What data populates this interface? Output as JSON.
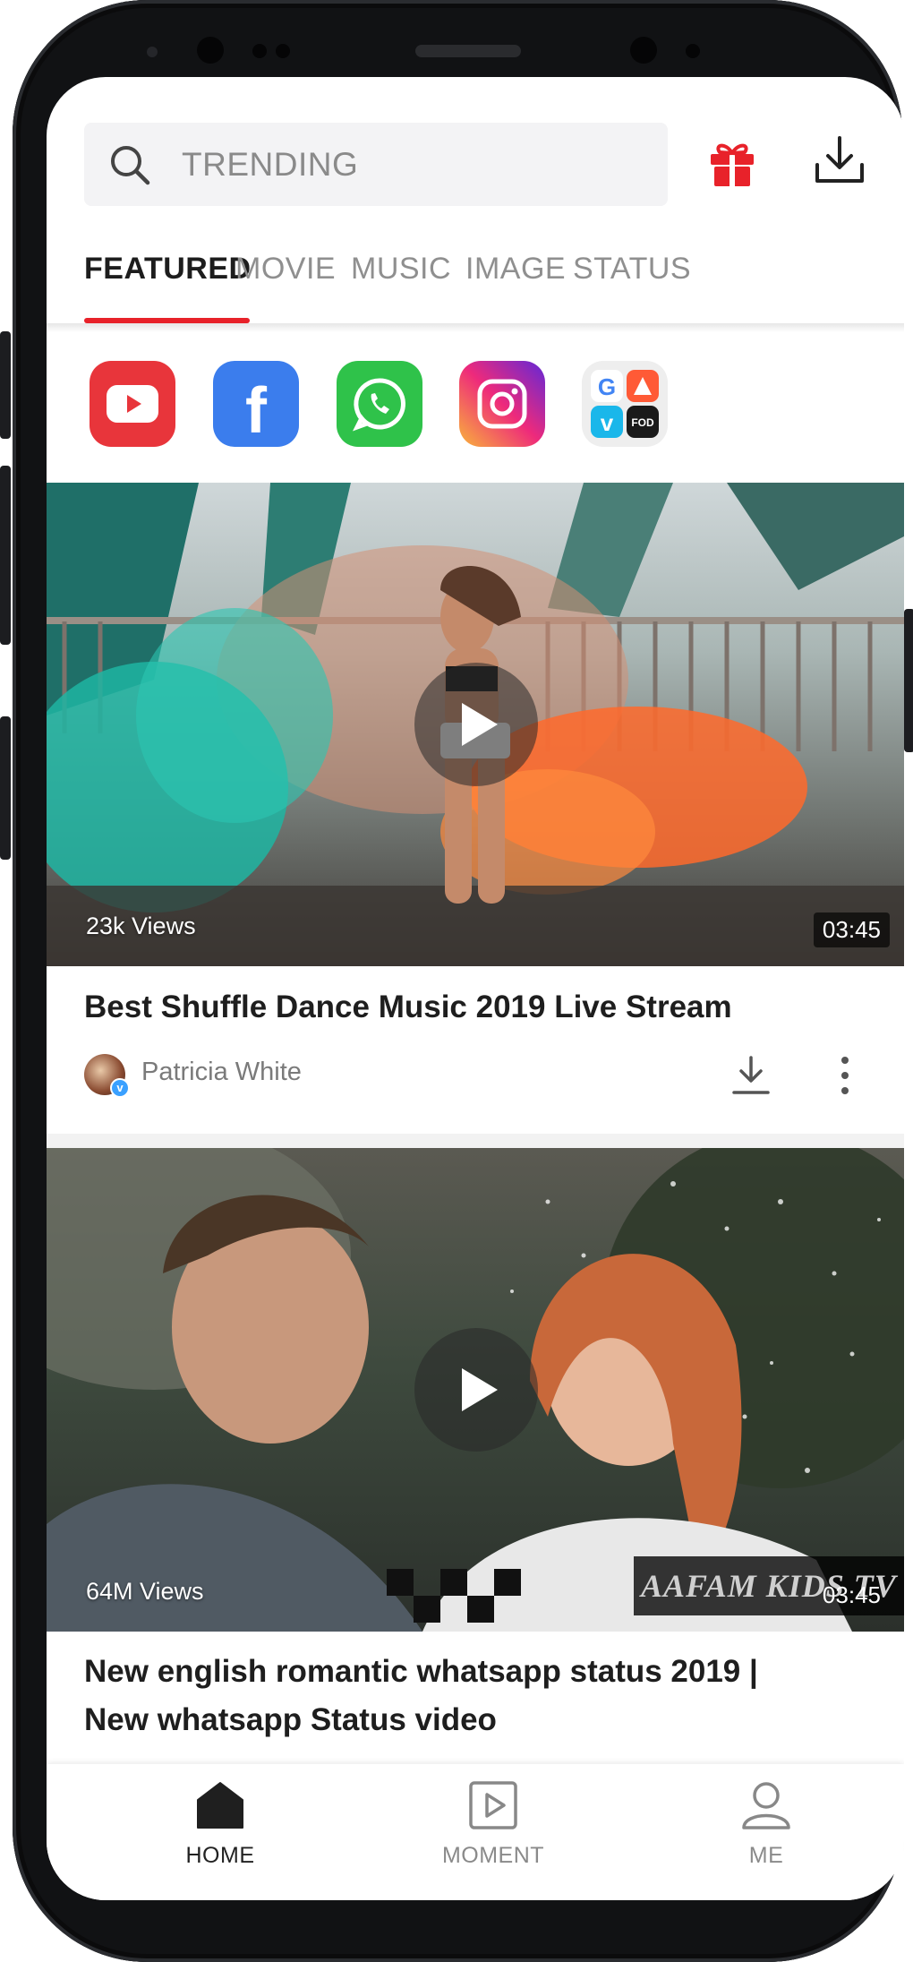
{
  "search": {
    "placeholder": "TRENDING",
    "icon": "search-icon"
  },
  "header": {
    "gift_icon": "gift-icon",
    "download_icon": "download-icon"
  },
  "tabs": [
    {
      "label": "FEATURED",
      "active": true
    },
    {
      "label": "MOVIE",
      "active": false
    },
    {
      "label": "MUSIC",
      "active": false
    },
    {
      "label": "IMAGE",
      "active": false
    },
    {
      "label": "STATUS",
      "active": false
    }
  ],
  "apps": [
    {
      "name": "youtube-icon",
      "color": "#e8353b"
    },
    {
      "name": "facebook-icon",
      "color": "#3b7ded"
    },
    {
      "name": "whatsapp-icon",
      "color": "#2fc24a"
    },
    {
      "name": "instagram-icon",
      "color": "#d62976"
    },
    {
      "name": "more-apps-icon",
      "color": "#eeeeee"
    }
  ],
  "videos": [
    {
      "views": "23k Views",
      "duration": "03:45",
      "title": "Best Shuffle Dance Music 2019 Live Stream",
      "author": "Patricia White",
      "verified_mark": "v"
    },
    {
      "views": "64M Views",
      "duration": "03:45",
      "watermark": "AAFAM KIDS TV",
      "title_line1": "New english romantic whatsapp status 2019 |",
      "title_line2": "New whatsapp Status video"
    }
  ],
  "bottom_nav": [
    {
      "label": "HOME",
      "icon": "home-icon",
      "active": true
    },
    {
      "label": "MOMENT",
      "icon": "moment-icon",
      "active": false
    },
    {
      "label": "ME",
      "icon": "profile-icon",
      "active": false
    }
  ],
  "colors": {
    "accent": "#e8222a",
    "text_dark": "#1e1e1e",
    "text_muted": "#8f8f8f"
  }
}
